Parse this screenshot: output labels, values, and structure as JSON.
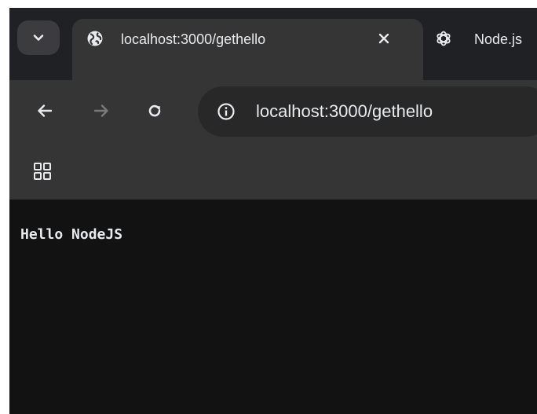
{
  "tabs": [
    {
      "title": "localhost:3000/gethello",
      "active": true,
      "icon": "globe-icon"
    },
    {
      "title": "Node.js",
      "active": false,
      "icon": "openai-icon"
    }
  ],
  "toolbar": {
    "url": "localhost:3000/gethello"
  },
  "page": {
    "body_text": "Hello NodeJS"
  },
  "colors": {
    "tab_strip": "#202124",
    "toolbar": "#353535",
    "omnibox": "#282828",
    "content_bg": "#121212",
    "text": "#e8eaed"
  }
}
